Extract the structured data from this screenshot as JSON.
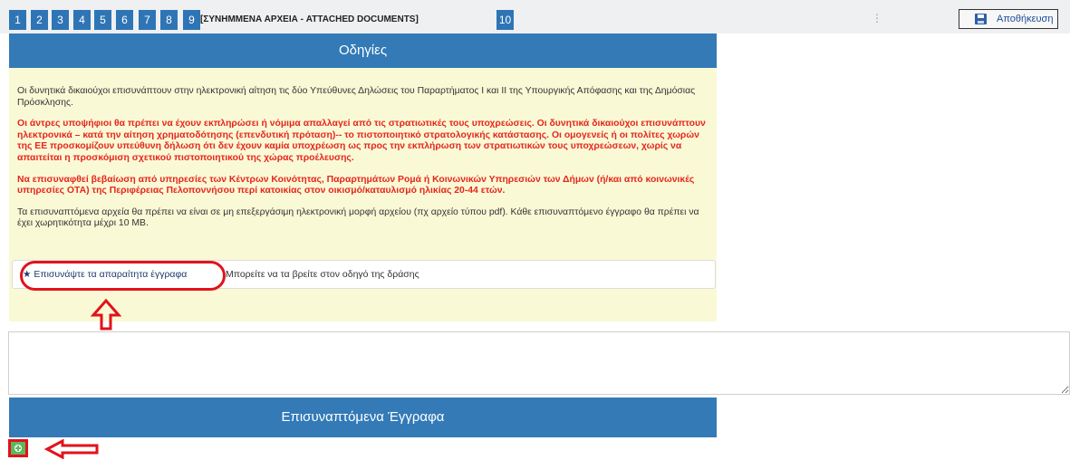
{
  "toolbar": {
    "steps": [
      "1",
      "2",
      "3",
      "4",
      "5",
      "6",
      "7",
      "8",
      "9",
      "10"
    ],
    "current_step_label": "[ΣΥΝΗΜΜΕΝΑ ΑΡΧΕΙΑ - ATTACHED DOCUMENTS]",
    "menu_dots": "⋮",
    "save_label": "Αποθήκευση",
    "save_icon": "floppy-disk-icon"
  },
  "instructions": {
    "title": "Οδηγίες",
    "paragraph_1": "Οι δυνητικά δικαιούχοι επισυνάπτουν στην ηλεκτρονική αίτηση τις δύο Υπεύθυνες Δηλώσεις του Παραρτήματος Ι και ΙΙ της Υπουργικής Απόφασης και της Δημόσιας Πρόσκλησης.",
    "paragraph_2": "Οι άντρες υποψήφιοι θα πρέπει να έχουν εκπληρώσει ή νόμιμα απαλλαγεί από τις στρατιωτικές τους υποχρεώσεις. Οι δυνητικά δικαιούχοι επισυνάπτουν ηλεκτρονικά – κατά την αίτηση χρηματοδότησης (επενδυτική πρόταση)-- το πιστοποιητικό στρατολογικής κατάστασης. Οι ομογενείς ή οι πολίτες χωρών της ΕΕ προσκομίζουν υπεύθυνη δήλωση ότι δεν έχουν καμία υποχρέωση ως προς την εκπλήρωση των στρατιωτικών τους υποχρεώσεων, χωρίς να απαιτείται η προσκόμιση σχετικού πιστοποιητικού της χώρας προέλευσης.",
    "paragraph_3": "Να επισυναφθεί βεβαίωση από υπηρεσίες των Κέντρων Κοινότητας, Παραρτημάτων Ρομά ή Κοινωνικών Υπηρεσιών των Δήμων (ή/και από κοινωνικές υπηρεσίες ΟΤΑ) της Περιφέρειας Πελοποννήσου περί κατοικίας στον οικισμό/καταυλισμό ηλικίας 20-44 ετών.",
    "paragraph_4": "Τα επισυναπτόμενα αρχεία θα πρέπει να είναι σε μη επεξεργάσιμη ηλεκτρονική μορφή αρχείου (πχ αρχείο τύπου pdf). Κάθε επισυναπτόμενο έγγραφο θα πρέπει να έχει χωρητικότητα μέχρι 10 MB.",
    "attach_link": "★ Επισυνάψτε τα απαραίτητα έγγραφα",
    "attach_hint": "Μπορείτε να τα βρείτε στον οδηγό της δράσης"
  },
  "comment": {
    "value": ""
  },
  "documents": {
    "title": "Επισυναπτόμενα Έγγραφα",
    "add_icon": "plus-circle-icon"
  },
  "colors": {
    "panel_blue": "#337ab7",
    "notice_bg": "#f9f9d6",
    "warning_red": "#e8261c",
    "highlight_red": "#e2121b",
    "add_green": "#5cb85c"
  }
}
